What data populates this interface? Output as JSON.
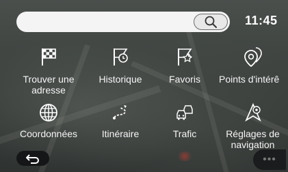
{
  "status": {
    "time": "11:45"
  },
  "search": {
    "value": ""
  },
  "menu": {
    "items": [
      {
        "label": "Trouver une adresse",
        "icon": "checkered-flag-icon"
      },
      {
        "label": "Historique",
        "icon": "history-flag-icon"
      },
      {
        "label": "Favoris",
        "icon": "favorite-flag-icon"
      },
      {
        "label": "Points d'intérê",
        "icon": "points-of-interest-icon"
      },
      {
        "label": "Coordonnées",
        "icon": "globe-icon"
      },
      {
        "label": "Itinéraire",
        "icon": "route-icon"
      },
      {
        "label": "Trafic",
        "icon": "traffic-cars-icon"
      },
      {
        "label": "Réglages de navigation",
        "icon": "navigation-settings-icon"
      }
    ]
  },
  "footer": {
    "back_icon": "back-arrow-icon",
    "more_icon": "more-icon"
  },
  "colors": {
    "background": "#3a3f3c",
    "search_bar": "#f4f4f4",
    "text": "#f5f5f5"
  }
}
